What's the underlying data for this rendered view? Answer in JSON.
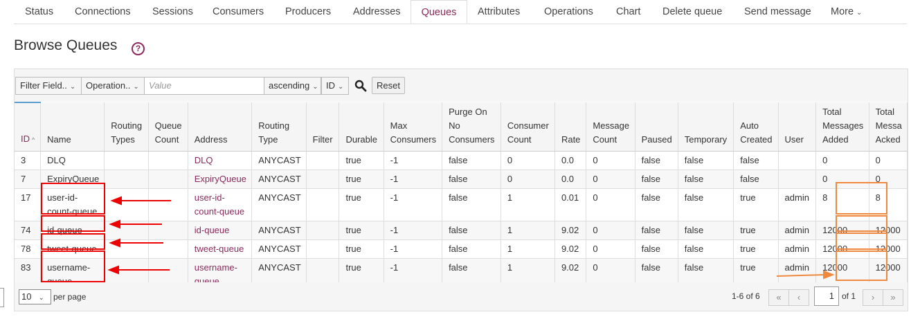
{
  "tabs": [
    {
      "label": "Status"
    },
    {
      "label": "Connections"
    },
    {
      "label": "Sessions"
    },
    {
      "label": "Consumers"
    },
    {
      "label": "Producers"
    },
    {
      "label": "Addresses"
    },
    {
      "label": "Queues"
    },
    {
      "label": "Attributes"
    },
    {
      "label": "Operations"
    },
    {
      "label": "Chart"
    },
    {
      "label": "Delete queue"
    },
    {
      "label": "Send message"
    },
    {
      "label": "More"
    }
  ],
  "active_tab": "Queues",
  "page": {
    "title": "Browse Queues",
    "help_icon": "?"
  },
  "filter": {
    "field": "Filter Field..",
    "operation": "Operation..",
    "value_placeholder": "Value",
    "order": "ascending",
    "sort_by": "ID",
    "reset": "Reset"
  },
  "columns": {
    "id": "ID",
    "name": "Name",
    "routing_types": "Routing Types",
    "queue_count": "Queue Count",
    "address": "Address",
    "routing_type": "Routing Type",
    "filter": "Filter",
    "durable": "Durable",
    "max_consumers": "Max Consumers",
    "purge": "Purge On No Consumers",
    "consumer_count": "Consumer Count",
    "rate": "Rate",
    "message_count": "Message Count",
    "paused": "Paused",
    "temporary": "Temporary",
    "auto_created": "Auto Created",
    "user": "User",
    "total_added": "Total Messages Added",
    "total_acked": "Total Messa Acked"
  },
  "rows": [
    {
      "id": "3",
      "name": "DLQ",
      "routing_types": "",
      "queue_count": "",
      "address": "DLQ",
      "routing_type": "ANYCAST",
      "filter": "",
      "durable": "true",
      "max_consumers": "-1",
      "purge": "false",
      "consumer_count": "0",
      "rate": "0.0",
      "message_count": "0",
      "paused": "false",
      "temporary": "false",
      "auto_created": "false",
      "user": "",
      "total_added": "0",
      "total_acked": "0"
    },
    {
      "id": "7",
      "name": "ExpiryQueue",
      "routing_types": "",
      "queue_count": "",
      "address": "ExpiryQueue",
      "routing_type": "ANYCAST",
      "filter": "",
      "durable": "true",
      "max_consumers": "-1",
      "purge": "false",
      "consumer_count": "0",
      "rate": "0.0",
      "message_count": "0",
      "paused": "false",
      "temporary": "false",
      "auto_created": "false",
      "user": "",
      "total_added": "0",
      "total_acked": "0"
    },
    {
      "id": "17",
      "name": "user-id-count-queue",
      "routing_types": "",
      "queue_count": "",
      "address": "user-id-count-queue",
      "routing_type": "ANYCAST",
      "filter": "",
      "durable": "true",
      "max_consumers": "-1",
      "purge": "false",
      "consumer_count": "1",
      "rate": "0.01",
      "message_count": "0",
      "paused": "false",
      "temporary": "false",
      "auto_created": "true",
      "user": "admin",
      "total_added": "8",
      "total_acked": "8"
    },
    {
      "id": "74",
      "name": "id-queue",
      "routing_types": "",
      "queue_count": "",
      "address": "id-queue",
      "routing_type": "ANYCAST",
      "filter": "",
      "durable": "true",
      "max_consumers": "-1",
      "purge": "false",
      "consumer_count": "1",
      "rate": "9.02",
      "message_count": "0",
      "paused": "false",
      "temporary": "false",
      "auto_created": "true",
      "user": "admin",
      "total_added": "12000",
      "total_acked": "12000"
    },
    {
      "id": "78",
      "name": "tweet-queue",
      "routing_types": "",
      "queue_count": "",
      "address": "tweet-queue",
      "routing_type": "ANYCAST",
      "filter": "",
      "durable": "true",
      "max_consumers": "-1",
      "purge": "false",
      "consumer_count": "1",
      "rate": "9.02",
      "message_count": "0",
      "paused": "false",
      "temporary": "false",
      "auto_created": "true",
      "user": "admin",
      "total_added": "12000",
      "total_acked": "12000"
    },
    {
      "id": "83",
      "name": "username-queue",
      "routing_types": "",
      "queue_count": "",
      "address": "username-queue",
      "routing_type": "ANYCAST",
      "filter": "",
      "durable": "true",
      "max_consumers": "-1",
      "purge": "false",
      "consumer_count": "1",
      "rate": "9.02",
      "message_count": "0",
      "paused": "false",
      "temporary": "false",
      "auto_created": "true",
      "user": "admin",
      "total_added": "12000",
      "total_acked": "12000"
    }
  ],
  "pagination": {
    "page_size": "10",
    "per_page_label": "per page",
    "range": "1-6 of 6",
    "current": "1",
    "of_label": "of 1"
  },
  "colors": {
    "accent": "#8a2a5c",
    "annotation_red": "#ee0000",
    "annotation_orange": "#f0883e"
  }
}
